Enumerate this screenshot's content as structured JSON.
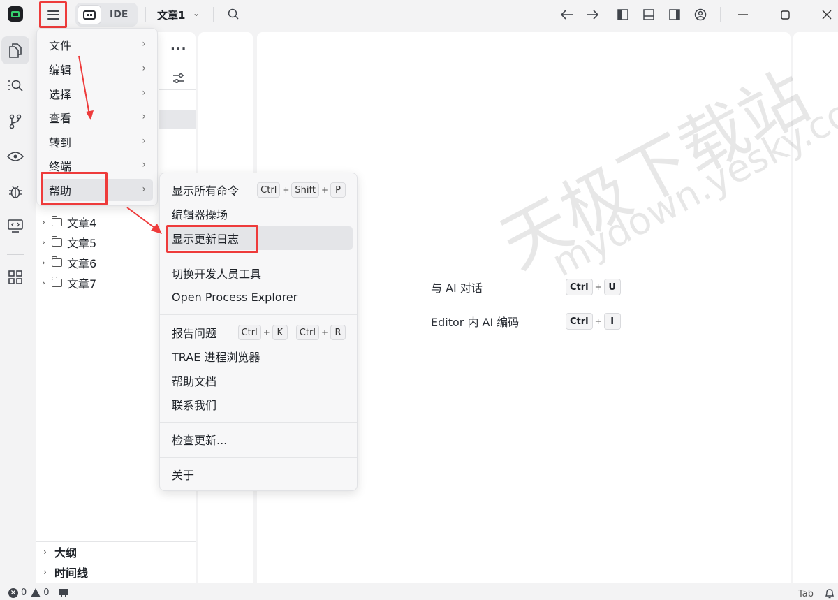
{
  "toolbar": {
    "mode_label": "IDE",
    "project_title": "文章1"
  },
  "sidebar": {
    "folders": [
      "文章4",
      "文章5",
      "文章6",
      "文章7"
    ],
    "outline_label": "大纲",
    "timeline_label": "时间线"
  },
  "main_menu": {
    "items": [
      "文件",
      "编辑",
      "选择",
      "查看",
      "转到",
      "终端",
      "帮助"
    ],
    "highlighted": "帮助"
  },
  "help_submenu": {
    "show_all_commands": {
      "label": "显示所有命令",
      "keys": [
        "Ctrl",
        "Shift",
        "P"
      ]
    },
    "editor_playground": "编辑器操场",
    "show_release_notes": "显示更新日志",
    "toggle_dev_tools": "切换开发人员工具",
    "open_process_explorer": "Open Process Explorer",
    "report_issue": {
      "label": "报告问题",
      "keys1": [
        "Ctrl",
        "K"
      ],
      "keys2": [
        "Ctrl",
        "R"
      ]
    },
    "trae_process_explorer": "TRAE 进程浏览器",
    "help_docs": "帮助文档",
    "contact_us": "联系我们",
    "check_updates": "检查更新...",
    "about": "关于",
    "plus": "+"
  },
  "editor": {
    "chat_ai": {
      "label": "与 AI 对话",
      "keys": [
        "Ctrl",
        "U"
      ]
    },
    "inline_ai": {
      "label": "Editor 内 AI 编码",
      "keys": [
        "Ctrl",
        "I"
      ]
    }
  },
  "watermark": {
    "cn": "天极下载站",
    "en": "mydown.yesky.com"
  },
  "statusbar": {
    "errors": "0",
    "warnings": "0",
    "tab_label": "Tab"
  },
  "colors": {
    "annotation_red": "#ee3b3b",
    "logo_green": "#36d16e"
  }
}
